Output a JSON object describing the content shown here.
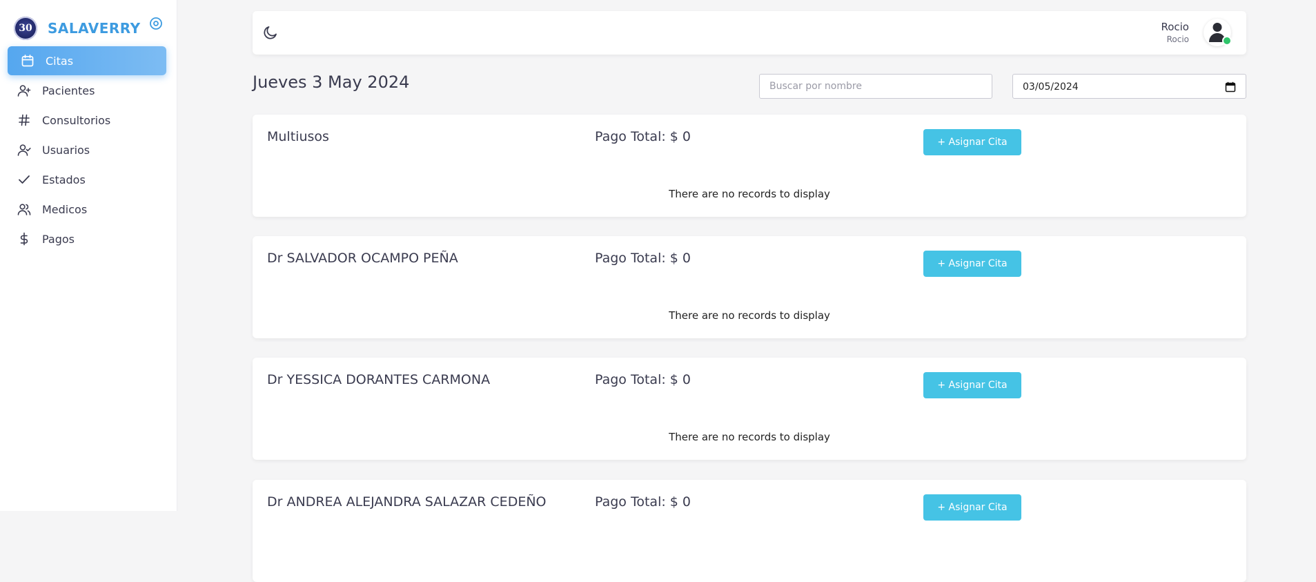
{
  "sidebar": {
    "brand": {
      "logo_text": "30",
      "name": "SALAVERRY"
    },
    "items": [
      {
        "label": "Citas",
        "icon": "calendar-icon",
        "active": true
      },
      {
        "label": "Pacientes",
        "icon": "user-plus-icon"
      },
      {
        "label": "Consultorios",
        "icon": "hash-icon"
      },
      {
        "label": "Usuarios",
        "icon": "user-check-icon"
      },
      {
        "label": "Estados",
        "icon": "check-icon"
      },
      {
        "label": "Medicos",
        "icon": "users-icon"
      },
      {
        "label": "Pagos",
        "icon": "dollar-icon"
      }
    ]
  },
  "header": {
    "theme_icon": "moon-icon",
    "user": {
      "name": "Rocio",
      "role": "Rocio",
      "status_color": "#2fc46a"
    }
  },
  "page": {
    "date_title": "Jueves 3 May 2024",
    "search_placeholder": "Buscar por nombre",
    "date_value": "03/05/2024"
  },
  "colors": {
    "accent": "#55a7ef",
    "button": "#45c3e5",
    "brand": "#3d9be0"
  },
  "cards": [
    {
      "title": "Multiusos",
      "total": "Pago Total: $ 0",
      "button": "+ Asignar Cita",
      "empty": "There are no records to display"
    },
    {
      "title": "Dr SALVADOR OCAMPO PEÑA",
      "total": "Pago Total: $ 0",
      "button": "+ Asignar Cita",
      "empty": "There are no records to display"
    },
    {
      "title": "Dr YESSICA DORANTES CARMONA",
      "total": "Pago Total: $ 0",
      "button": "+ Asignar Cita",
      "empty": "There are no records to display"
    },
    {
      "title": "Dr ANDREA ALEJANDRA SALAZAR CEDEÑO",
      "total": "Pago Total: $ 0",
      "button": "+ Asignar Cita",
      "empty": ""
    }
  ]
}
